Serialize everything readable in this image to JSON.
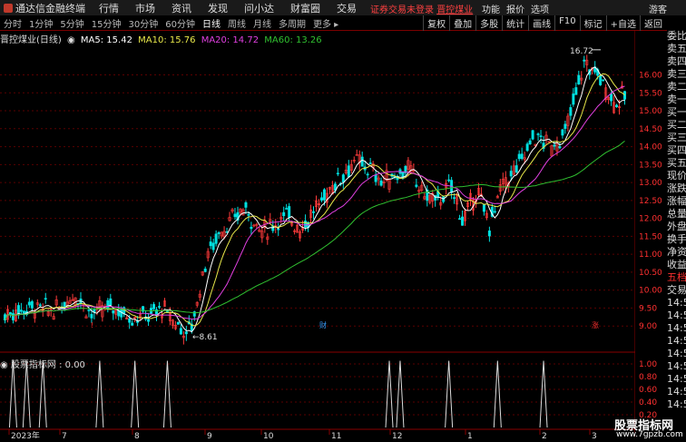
{
  "app": {
    "title": "通达信金融终端",
    "menus": [
      "行情",
      "市场",
      "资讯",
      "发现",
      "问小达",
      "财富圈",
      "交易"
    ],
    "notice": "证券交易未登录",
    "stock_link": "晋控煤业",
    "right_items": [
      "功能",
      "报价",
      "选项",
      "游客"
    ]
  },
  "periods": [
    {
      "label": "分时"
    },
    {
      "label": "1分钟"
    },
    {
      "label": "5分钟"
    },
    {
      "label": "15分钟"
    },
    {
      "label": "30分钟"
    },
    {
      "label": "60分钟"
    },
    {
      "label": "日线",
      "active": true
    },
    {
      "label": "周线"
    },
    {
      "label": "月线"
    },
    {
      "label": "多周期"
    },
    {
      "label": "更多 ▸"
    }
  ],
  "toolbar": [
    "复权",
    "叠加",
    "多股",
    "统计",
    "画线",
    "F10",
    "标记",
    "+自选",
    "返回"
  ],
  "legend": {
    "stock": "晋控煤业(日线)",
    "ma5": "MA5: 15.42",
    "ma10": "MA10: 15.76",
    "ma20": "MA20: 14.72",
    "ma60": "MA60: 13.26"
  },
  "colors": {
    "ma5": "#ffffff",
    "ma10": "#e8e84a",
    "ma20": "#e040e0",
    "ma60": "#30c030",
    "up": "#ff3b3b",
    "down": "#00e0e0"
  },
  "price_axis": [
    "16.00",
    "15.50",
    "15.00",
    "14.50",
    "14.00",
    "13.50",
    "13.00",
    "12.50",
    "12.00",
    "11.50",
    "11.00",
    "10.50",
    "10.00",
    "9.50",
    "9.00"
  ],
  "indicator_axis": [
    "1.00",
    "0.80",
    "0.60",
    "0.40",
    "0.20"
  ],
  "indicator": {
    "label": "股票指标网 : 0.00"
  },
  "time_axis": [
    "2023年",
    "7",
    "8",
    "9",
    "10",
    "11",
    "12",
    "1",
    "2",
    "3"
  ],
  "annotations": {
    "high": "16.72",
    "low": "8.61"
  },
  "markers": [
    {
      "text": "财"
    },
    {
      "text": "涨"
    }
  ],
  "side_panel": [
    "委比",
    "卖五",
    "卖四",
    "卖三",
    "卖二",
    "卖一",
    "买一",
    "买二",
    "买三",
    "买四",
    "买五",
    "现价",
    "涨跌",
    "涨幅",
    "总量",
    "外盘",
    "换手",
    "净资",
    "收益",
    "五档",
    "交易",
    "14:5",
    "14:5",
    "14:5",
    "14:5",
    "14:5",
    "14:5",
    "14:5",
    "14:5",
    "14:5"
  ],
  "watermark": {
    "title": "股票指标网",
    "url": "www.7gpzb.com"
  },
  "chart_data": {
    "type": "candlestick",
    "ylim": [
      8.6,
      17.0
    ],
    "spike_days": [
      3,
      8,
      14,
      35,
      48,
      60,
      142,
      146,
      164,
      182,
      199
    ]
  }
}
